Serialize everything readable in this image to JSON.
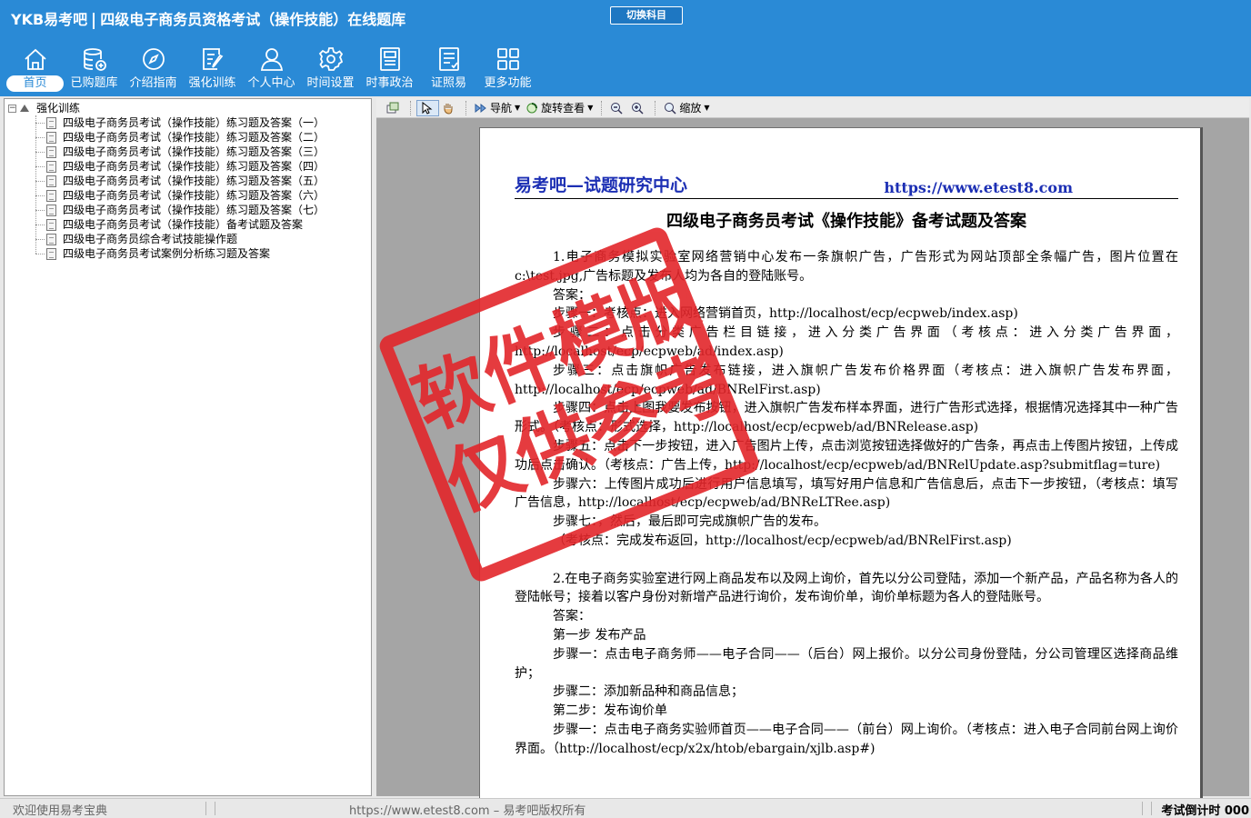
{
  "app": {
    "brand": "YKB易考吧",
    "title": "四级电子商务员资格考试（操作技能）在线题库",
    "switch_subject": "切换科目"
  },
  "nav": [
    {
      "label": "首页",
      "icon": "home-icon"
    },
    {
      "label": "已购题库",
      "icon": "database-icon"
    },
    {
      "label": "介绍指南",
      "icon": "compass-icon"
    },
    {
      "label": "强化训练",
      "icon": "edit-icon"
    },
    {
      "label": "个人中心",
      "icon": "user-icon"
    },
    {
      "label": "时间设置",
      "icon": "gear-icon"
    },
    {
      "label": "时事政治",
      "icon": "newspaper-icon"
    },
    {
      "label": "证照易",
      "icon": "checklist-icon"
    },
    {
      "label": "更多功能",
      "icon": "grid-icon"
    }
  ],
  "tree": {
    "root": "强化训练",
    "items": [
      "四级电子商务员考试（操作技能）练习题及答案（一）",
      "四级电子商务员考试（操作技能）练习题及答案（二）",
      "四级电子商务员考试（操作技能）练习题及答案（三）",
      "四级电子商务员考试（操作技能）练习题及答案（四）",
      "四级电子商务员考试（操作技能）练习题及答案（五）",
      "四级电子商务员考试（操作技能）练习题及答案（六）",
      "四级电子商务员考试（操作技能）练习题及答案（七）",
      "四级电子商务员考试（操作技能）备考试题及答案",
      "四级电子商务员综合考试技能操作题",
      "四级电子商务员考试案例分析练习题及答案"
    ]
  },
  "toolbar": {
    "navigate": "导航",
    "rotate": "旋转查看",
    "zoom": "缩放"
  },
  "document": {
    "header_left": "易考吧—试题研究中心",
    "header_right": "https://www.etest8.com",
    "title": "四级电子商务员考试《操作技能》备考试题及答案",
    "paragraphs": [
      "1.电子商务模拟实验室网络营销中心发布一条旗帜广告，广告形式为网站顶部全条幅广告，图片位置在c:\\test.jpg,广告标题及发布人均为各自的登陆账号。",
      "答案：",
      "步骤一：考核点：进入网络营销首页，http://localhost/ecp/ecpweb/index.asp)",
      "步骤二：点击分类广告栏目链接，进入分类广告界面（考核点：进入分类广告界面，http://localhost/ecp/ecpweb/ad/index.asp)",
      "步骤三：点击旗帜广告发布链接，进入旗帜广告发布价格界面（考核点：进入旗帜广告发布界面，http://localhost/ecp/ecpweb/ad/BNRelFirst.asp)",
      "步骤四：点击上图我要发布按钮，进入旗帜广告发布样本界面，进行广告形式选择，根据情况选择其中一种广告形式。（考核点：形式选择，http://localhost/ecp/ecpweb/ad/BNRelease.asp)",
      "步骤五：点击下一步按钮，进入广告图片上传，点击浏览按钮选择做好的广告条，再点击上传图片按钮，上传成功后点击确认。（考核点：广告上传，http://localhost/ecp/ecpweb/ad/BNRelUpdate.asp?submitflag=ture)",
      "步骤六：上传图片成功后进行用户信息填写，填写好用户信息和广告信息后，点击下一步按钮，（考核点：填写广告信息，http://localhost/ecp/ecpweb/ad/BNReLTRee.asp)",
      "步骤七：，然后，最后即可完成旗帜广告的发布。",
      "（考核点：完成发布返回，http://localhost/ecp/ecpweb/ad/BNRelFirst.asp)",
      "",
      "2.在电子商务实验室进行网上商品发布以及网上询价，首先以分公司登陆，添加一个新产品，产品名称为各人的登陆帐号；接着以客户身份对新增产品进行询价，发布询价单，询价单标题为各人的登陆账号。",
      "答案：",
      "第一步 发布产品",
      "步骤一：点击电子商务师——电子合同——（后台）网上报价。以分公司身份登陆，分公司管理区选择商品维护；",
      "步骤二：添加新品种和商品信息；",
      "第二步：发布询价单",
      "步骤一：点击电子商务实验师首页——电子合同——（前台）网上询价。（考核点：进入电子合同前台网上询价界面。（http://localhost/ecp/x2x/htob/ebargain/xjlb.asp#)"
    ],
    "stamp_line1": "软件模版",
    "stamp_line2": "仅供参考"
  },
  "status": {
    "welcome": "欢迎使用易考宝典",
    "copyright": "https://www.etest8.com – 易考吧版权所有",
    "countdown": "考试倒计时 000"
  },
  "colors": {
    "header_bg": "#2a8ad6",
    "doc_header": "#1c2fb4",
    "stamp": "#e3262b"
  }
}
